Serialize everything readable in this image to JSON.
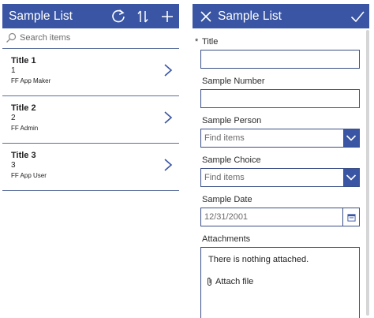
{
  "list_screen": {
    "title": "Sample List",
    "icons": {
      "refresh": "refresh-icon",
      "sort": "sort-icon",
      "add": "add-icon"
    },
    "search": {
      "placeholder": "Search items"
    },
    "items": [
      {
        "title": "Title 1",
        "number": "1",
        "person": "FF App Maker"
      },
      {
        "title": "Title 2",
        "number": "2",
        "person": "FF Admin"
      },
      {
        "title": "Title 3",
        "number": "3",
        "person": "FF App User"
      }
    ]
  },
  "edit_screen": {
    "title": "Sample List",
    "icons": {
      "close": "close-icon",
      "submit": "checkmark-icon"
    },
    "fields": {
      "title": {
        "label": "Title",
        "required_marker": "*",
        "value": ""
      },
      "sample_number": {
        "label": "Sample Number",
        "value": ""
      },
      "sample_person": {
        "label": "Sample Person",
        "placeholder": "Find items"
      },
      "sample_choice": {
        "label": "Sample Choice",
        "placeholder": "Find items"
      },
      "sample_date": {
        "label": "Sample Date",
        "value": "12/31/2001"
      },
      "attachments": {
        "label": "Attachments",
        "empty_text": "There is nothing attached.",
        "attach_label": "Attach file"
      }
    }
  },
  "colors": {
    "header": "#3955a3",
    "border": "#3a4f86",
    "divider": "#5c6f9c"
  }
}
